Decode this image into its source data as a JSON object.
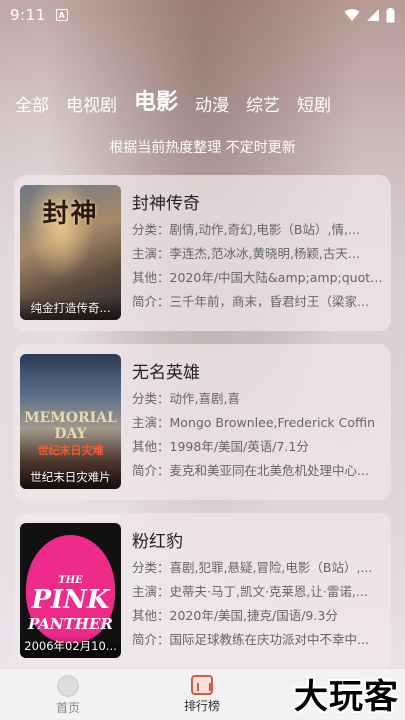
{
  "status_bar": {
    "time": "9:11",
    "badge": "A"
  },
  "tabs": [
    {
      "label": "全部",
      "active": false
    },
    {
      "label": "电视剧",
      "active": false
    },
    {
      "label": "电影",
      "active": true
    },
    {
      "label": "动漫",
      "active": false
    },
    {
      "label": "综艺",
      "active": false
    },
    {
      "label": "短剧",
      "active": false
    }
  ],
  "subtitle": "根据当前热度整理 不定时更新",
  "movies": [
    {
      "title": "封神传奇",
      "poster_title": "封神",
      "caption": "纯金打造传奇...",
      "genre_label": "分类：",
      "genre": "剧情,动作,奇幻,电影（B站）,情,...",
      "cast_label": "主演：",
      "cast": "李连杰,范冰冰,黄晓明,杨颖,古天...",
      "other_label": "其他：",
      "other": "2020年/中国大陆&amp;amp;quot;...",
      "intro_label": "简介：",
      "intro": "三千年前，商末，昏君纣王（梁家..."
    },
    {
      "title": "无名英雄",
      "poster_title": "MEMORIAL DAY",
      "poster_sub": "世纪末日灾难",
      "caption": "世纪末日灾难片",
      "genre_label": "分类：",
      "genre": "动作,喜剧,喜",
      "cast_label": "主演：",
      "cast": "Mongo Brownlee,Frederick Coffin",
      "other_label": "其他：",
      "other": "1998年/美国/英语/7.1分",
      "intro_label": "简介：",
      "intro": "麦克和美亚同在北美危机处理中心..."
    },
    {
      "title": "粉红豹",
      "poster_title_1": "THE",
      "poster_title_2": "PINK",
      "poster_title_3": "PANTHER",
      "caption": "2006年02月10...",
      "genre_label": "分类：",
      "genre": "喜剧,犯罪,悬疑,冒险,电影（B站）,...",
      "cast_label": "主演：",
      "cast": "史蒂夫·马丁,凯文·克莱恩,让·雷诺,...",
      "other_label": "其他：",
      "other": "2020年/美国,捷克/国语/9.3分",
      "intro_label": "简介：",
      "intro": "国际足球教练在庆功派对中不幸中..."
    }
  ],
  "bottom_nav": {
    "home_label": "首页",
    "rank_label": "排行榜"
  },
  "watermark": "大玩客",
  "colors": {
    "accent": "#d35a45",
    "pink": "#ee2a8a"
  }
}
